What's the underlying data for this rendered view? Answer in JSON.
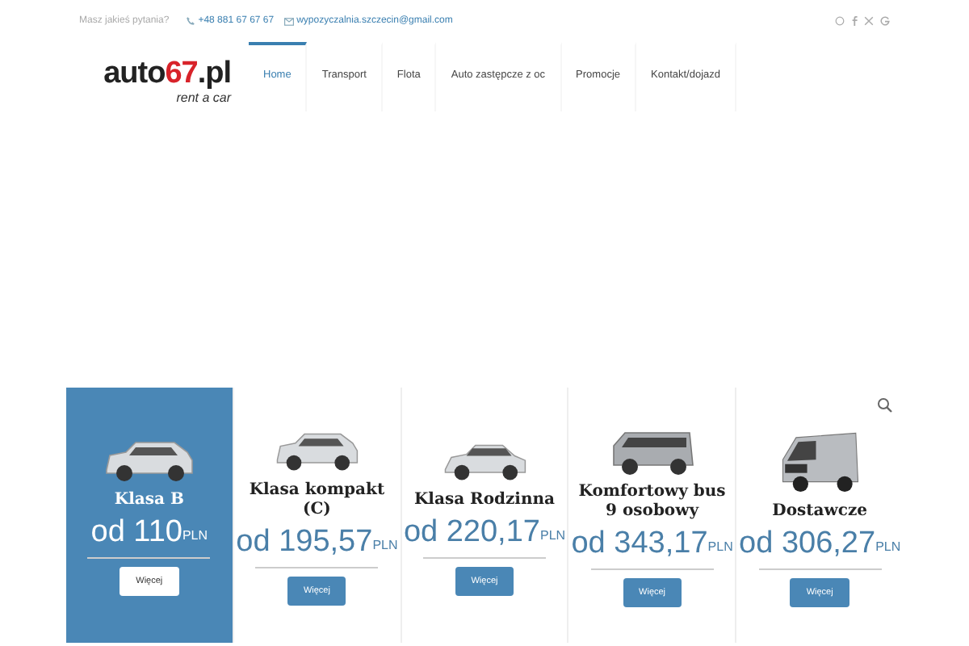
{
  "top_bar": {
    "question": "Masz jakieś pytania?",
    "phone": "+48 881 67 67 67",
    "email": "wypozyczalnia.szczecin@gmail.com"
  },
  "logo": {
    "word": "auto",
    "number": "67",
    "domain": ".pl",
    "tagline": "rent a car"
  },
  "nav": [
    {
      "label": "Home",
      "selected": true
    },
    {
      "label": "Transport",
      "selected": false
    },
    {
      "label": "Flota",
      "selected": false
    },
    {
      "label": "Auto zastępcze z oc",
      "selected": false
    },
    {
      "label": "Promocje",
      "selected": false
    },
    {
      "label": "Kontakt/dojazd",
      "selected": false
    }
  ],
  "cards": [
    {
      "kind": "wagon",
      "title": "Klasa B",
      "prefix": "od",
      "amount": "110",
      "currency": "PLN",
      "button": "Więcej",
      "highlighted": true
    },
    {
      "kind": "hatchback",
      "title": "Klasa kompakt (C)",
      "prefix": "od",
      "amount": "195,57",
      "currency": "PLN",
      "button": "Więcej",
      "highlighted": false
    },
    {
      "kind": "sedan",
      "title": "Klasa Rodzinna",
      "prefix": "od",
      "amount": "220,17",
      "currency": "PLN",
      "button": "Więcej",
      "highlighted": false
    },
    {
      "kind": "bus",
      "title": "Komfortowy bus 9 osobowy",
      "prefix": "od",
      "amount": "343,17",
      "currency": "PLN",
      "button": "Więcej",
      "highlighted": false
    },
    {
      "kind": "van",
      "title": "Dostawcze",
      "prefix": "od",
      "amount": "306,27",
      "currency": "PLN",
      "button": "Więcej",
      "highlighted": false
    }
  ]
}
